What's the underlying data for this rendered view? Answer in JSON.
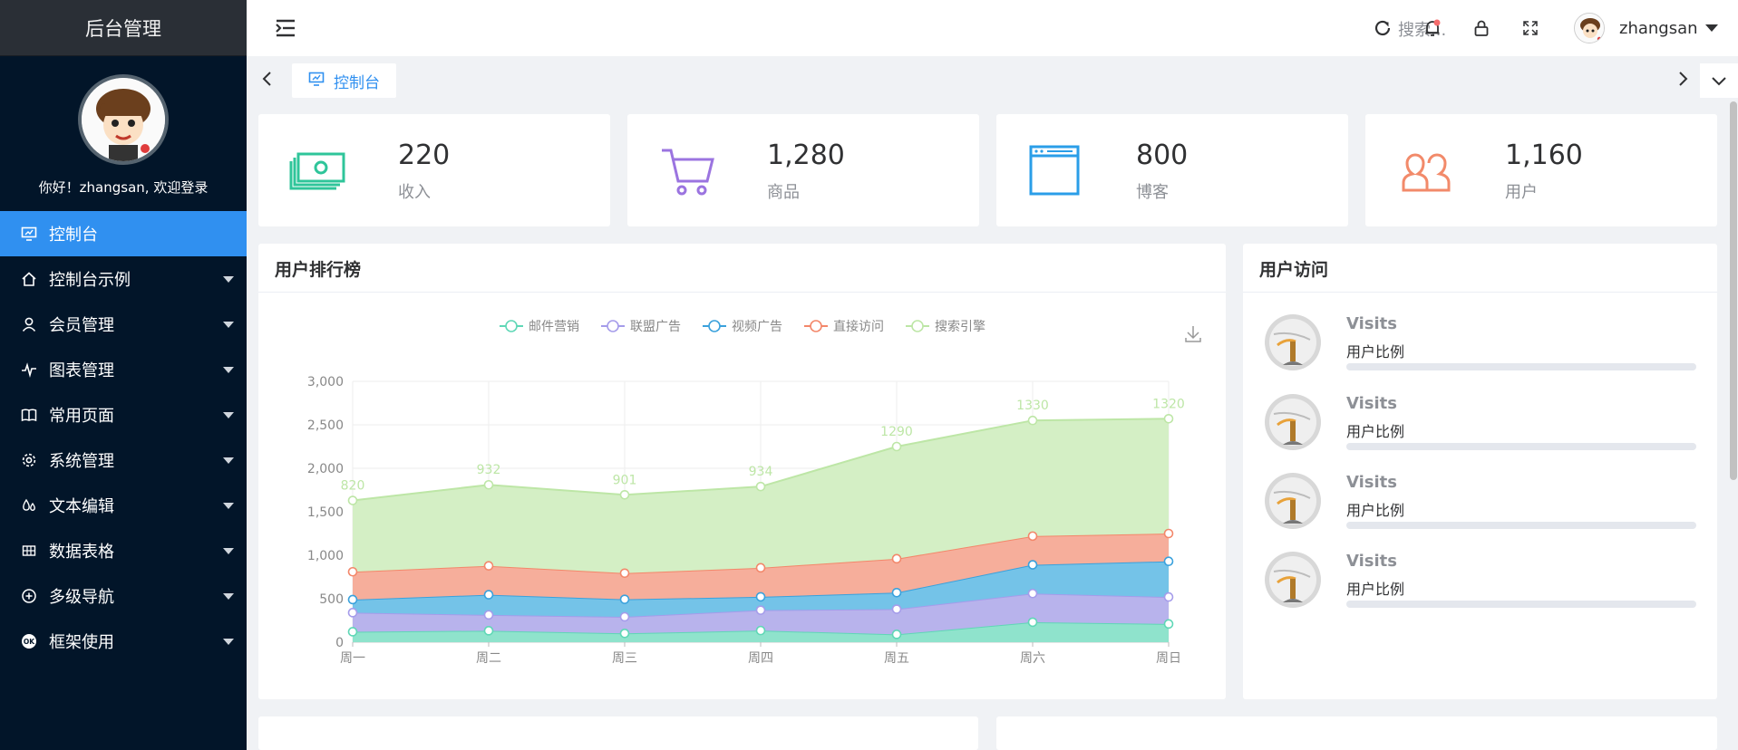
{
  "sidebar": {
    "title": "后台管理",
    "greeting": "你好！zhangsan, 欢迎登录",
    "items": [
      {
        "label": "控制台",
        "icon": "monitor-icon",
        "active": true
      },
      {
        "label": "控制台示例",
        "icon": "home-icon"
      },
      {
        "label": "会员管理",
        "icon": "user-icon"
      },
      {
        "label": "图表管理",
        "icon": "pulse-icon"
      },
      {
        "label": "常用页面",
        "icon": "book-icon"
      },
      {
        "label": "系统管理",
        "icon": "gear-icon"
      },
      {
        "label": "文本编辑",
        "icon": "drops-icon"
      },
      {
        "label": "数据表格",
        "icon": "grid-icon"
      },
      {
        "label": "多级导航",
        "icon": "plus-circle-icon"
      },
      {
        "label": "框架使用",
        "icon": "ok-icon"
      }
    ]
  },
  "header": {
    "search_placeholder": "搜索...",
    "username": "zhangsan"
  },
  "tabs": [
    {
      "label": "控制台",
      "icon": "monitor-icon",
      "active": true
    }
  ],
  "stats": [
    {
      "value": "220",
      "label": "收入",
      "icon": "money-icon",
      "color": "#2fc59a"
    },
    {
      "value": "1,280",
      "label": "商品",
      "icon": "cart-icon",
      "color": "#9b74e0"
    },
    {
      "value": "800",
      "label": "博客",
      "icon": "browser-icon",
      "color": "#2a9ee8"
    },
    {
      "value": "1,160",
      "label": "用户",
      "icon": "users-icon",
      "color": "#f28a6a"
    }
  ],
  "ranking_panel": {
    "title": "用户排行榜"
  },
  "visits_panel": {
    "title": "用户访问",
    "rows": [
      {
        "title": "Visits",
        "subtitle": "用户比例",
        "progress": 0
      },
      {
        "title": "Visits",
        "subtitle": "用户比例",
        "progress": 0
      },
      {
        "title": "Visits",
        "subtitle": "用户比例",
        "progress": 0
      },
      {
        "title": "Visits",
        "subtitle": "用户比例",
        "progress": 0
      }
    ]
  },
  "chart_data": {
    "type": "area",
    "stacked": true,
    "categories": [
      "周一",
      "周二",
      "周三",
      "周四",
      "周五",
      "周六",
      "周日"
    ],
    "ylim": [
      0,
      3000
    ],
    "yticks": [
      "0",
      "500",
      "1,000",
      "1,500",
      "2,000",
      "2,500",
      "3,000"
    ],
    "legend_position": "top-center",
    "grid": true,
    "series": [
      {
        "name": "邮件营销",
        "color": "#5fd7b6",
        "fill": "#8fe3cc",
        "values": [
          120,
          132,
          101,
          134,
          90,
          230,
          210
        ]
      },
      {
        "name": "联盟广告",
        "color": "#a59cea",
        "fill": "#b8b3ec",
        "values": [
          220,
          182,
          191,
          234,
          290,
          330,
          310
        ]
      },
      {
        "name": "视频广告",
        "color": "#3aa1dc",
        "fill": "#74c3e8",
        "values": [
          150,
          232,
          201,
          154,
          190,
          330,
          410
        ]
      },
      {
        "name": "直接访问",
        "color": "#f3876a",
        "fill": "#f6ae9b",
        "values": [
          320,
          332,
          301,
          334,
          390,
          330,
          320
        ]
      },
      {
        "name": "搜索引擎",
        "color": "#bde6a6",
        "fill": "#d4efc5",
        "values": [
          820,
          932,
          901,
          934,
          1290,
          1330,
          1320
        ],
        "labels": [
          "820",
          "932",
          "901",
          "934",
          "1290",
          "1330",
          "1320"
        ]
      }
    ]
  }
}
